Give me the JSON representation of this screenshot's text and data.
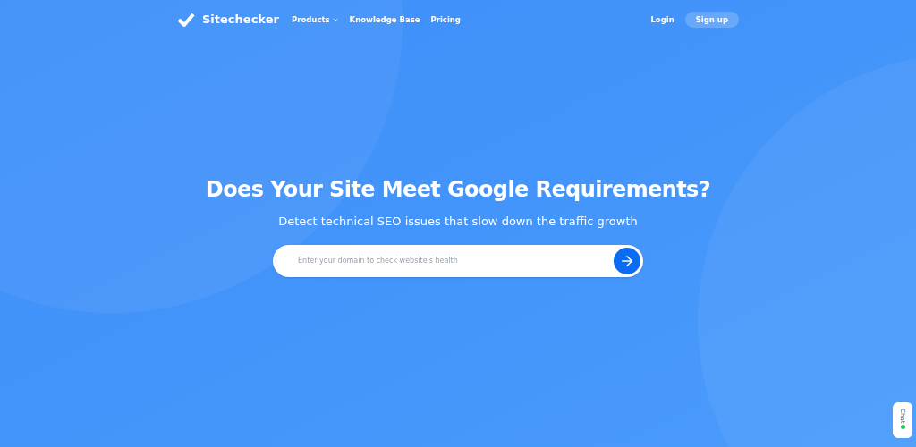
{
  "header": {
    "logo": "Sitechecker",
    "nav": [
      {
        "label": "Products",
        "dropdown": true
      },
      {
        "label": "Knowledge Base",
        "dropdown": false
      },
      {
        "label": "Pricing",
        "dropdown": false
      }
    ],
    "login": "Login",
    "signup": "Sign up"
  },
  "hero": {
    "title": "Does Your Site Meet Google Requirements?",
    "subtitle": "Detect technical SEO issues that slow down the traffic growth",
    "search": {
      "placeholder": "Enter your domain to check website's health"
    }
  },
  "chat": {
    "label": "Chat",
    "online": true
  }
}
